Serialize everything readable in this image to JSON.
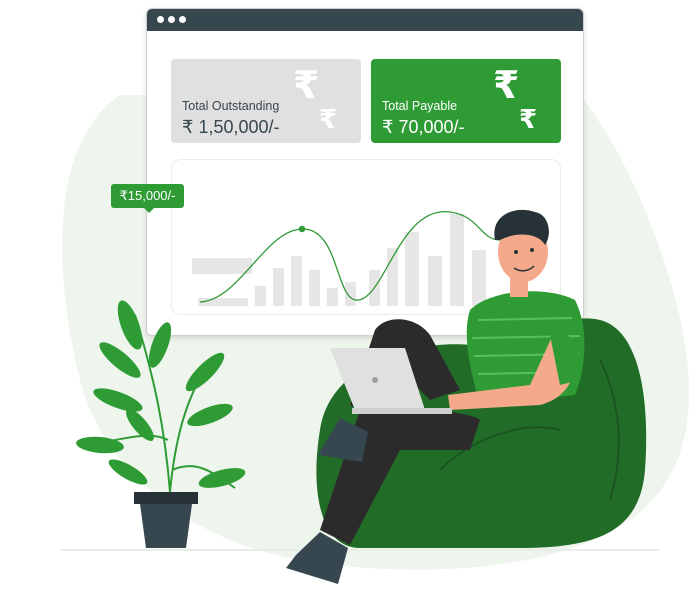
{
  "window": {
    "traffic_dots": [
      "dot",
      "dot",
      "dot"
    ]
  },
  "cards": {
    "outstanding": {
      "label": "Total Outstanding",
      "value": "₹ 1,50,000/-",
      "icon": "rupee-icon",
      "color": "#e0e0e0"
    },
    "payable": {
      "label": "Total Payable",
      "value": "₹ 70,000/-",
      "icon": "rupee-icon",
      "color": "#2e9b35"
    }
  },
  "chart": {
    "tooltip_value": "₹15,000/-",
    "accent": "#2e9b35",
    "bar_color": "#e6e6e6"
  },
  "illustration": {
    "person": "man-with-laptop",
    "seat": "green-bean-bag",
    "plant": "potted-plant",
    "colors": {
      "shirt": "#2e9b35",
      "beanbag": "#216d28",
      "pants": "#2b2b2b",
      "skin": "#f4a98b",
      "blob": "#eef5ec"
    }
  }
}
